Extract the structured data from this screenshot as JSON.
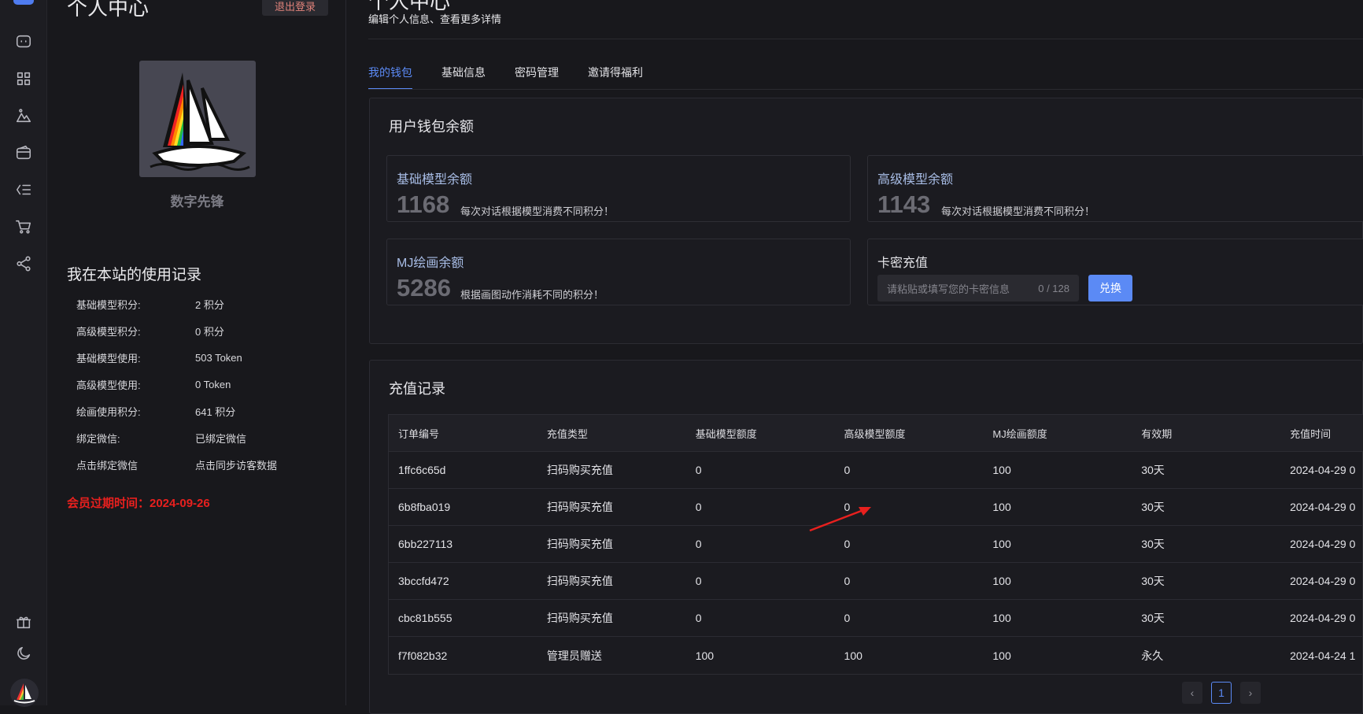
{
  "rail": {
    "icons": [
      "chat-icon",
      "apps-grid-icon",
      "drawing-mountain-icon",
      "wallet-icon",
      "order-list-icon",
      "shopping-cart-icon",
      "share-icon",
      "gift-icon",
      "moon-icon"
    ]
  },
  "profile": {
    "title": "个人中心",
    "logout_label": "退出登录",
    "nickname": "数字先锋",
    "usage_title": "我在本站的使用记录",
    "usage": [
      {
        "label": "基础模型积分:",
        "value": "2 积分"
      },
      {
        "label": "高级模型积分:",
        "value": "0 积分"
      },
      {
        "label": "基础模型使用:",
        "value": "503 Token"
      },
      {
        "label": "高级模型使用:",
        "value": "0 Token"
      },
      {
        "label": "绘画使用积分:",
        "value": "641 积分"
      },
      {
        "label": "绑定微信:",
        "value": "已绑定微信"
      },
      {
        "label": "点击绑定微信",
        "value": "点击同步访客数据"
      }
    ],
    "expire_text": "会员过期时间：2024-09-26"
  },
  "header": {
    "title": "个人中心",
    "subtitle": "编辑个人信息、查看更多详情"
  },
  "tabs": [
    {
      "label": "我的钱包",
      "active": true
    },
    {
      "label": "基础信息",
      "active": false
    },
    {
      "label": "密码管理",
      "active": false
    },
    {
      "label": "邀请得福利",
      "active": false
    }
  ],
  "wallet": {
    "title": "用户钱包余额",
    "basic": {
      "label": "基础模型余额",
      "amount": "1168",
      "desc": "每次对话根据模型消费不同积分！"
    },
    "advanced": {
      "label": "高级模型余额",
      "amount": "1143",
      "desc": "每次对话根据模型消费不同积分！"
    },
    "mj": {
      "label": "MJ绘画余额",
      "amount": "5286",
      "desc": "根据画图动作消耗不同的积分！"
    },
    "redeem": {
      "label": "卡密充值",
      "placeholder": "请粘贴或填写您的卡密信息",
      "counter": "0 / 128",
      "button": "兑换"
    }
  },
  "records": {
    "title": "充值记录",
    "columns": [
      "订单编号",
      "充值类型",
      "基础模型额度",
      "高级模型额度",
      "MJ绘画额度",
      "有效期",
      "充值时间"
    ],
    "rows": [
      [
        "1ffc6c65d",
        "扫码购买充值",
        "0",
        "0",
        "100",
        "30天",
        "2024-04-29 0"
      ],
      [
        "6b8fba019",
        "扫码购买充值",
        "0",
        "0",
        "100",
        "30天",
        "2024-04-29 0"
      ],
      [
        "6bb227113",
        "扫码购买充值",
        "0",
        "0",
        "100",
        "30天",
        "2024-04-29 0"
      ],
      [
        "3bccfd472",
        "扫码购买充值",
        "0",
        "0",
        "100",
        "30天",
        "2024-04-29 0"
      ],
      [
        "cbc81b555",
        "扫码购买充值",
        "0",
        "0",
        "100",
        "30天",
        "2024-04-29 0"
      ],
      [
        "f7f082b32",
        "管理员赠送",
        "100",
        "100",
        "100",
        "永久",
        "2024-04-24 1"
      ]
    ],
    "pager": {
      "prev": "‹",
      "current": "1",
      "next": "›"
    }
  },
  "colors": {
    "accent": "#5b8af5",
    "expire": "#e8201e",
    "arrow": "#e8201e"
  }
}
